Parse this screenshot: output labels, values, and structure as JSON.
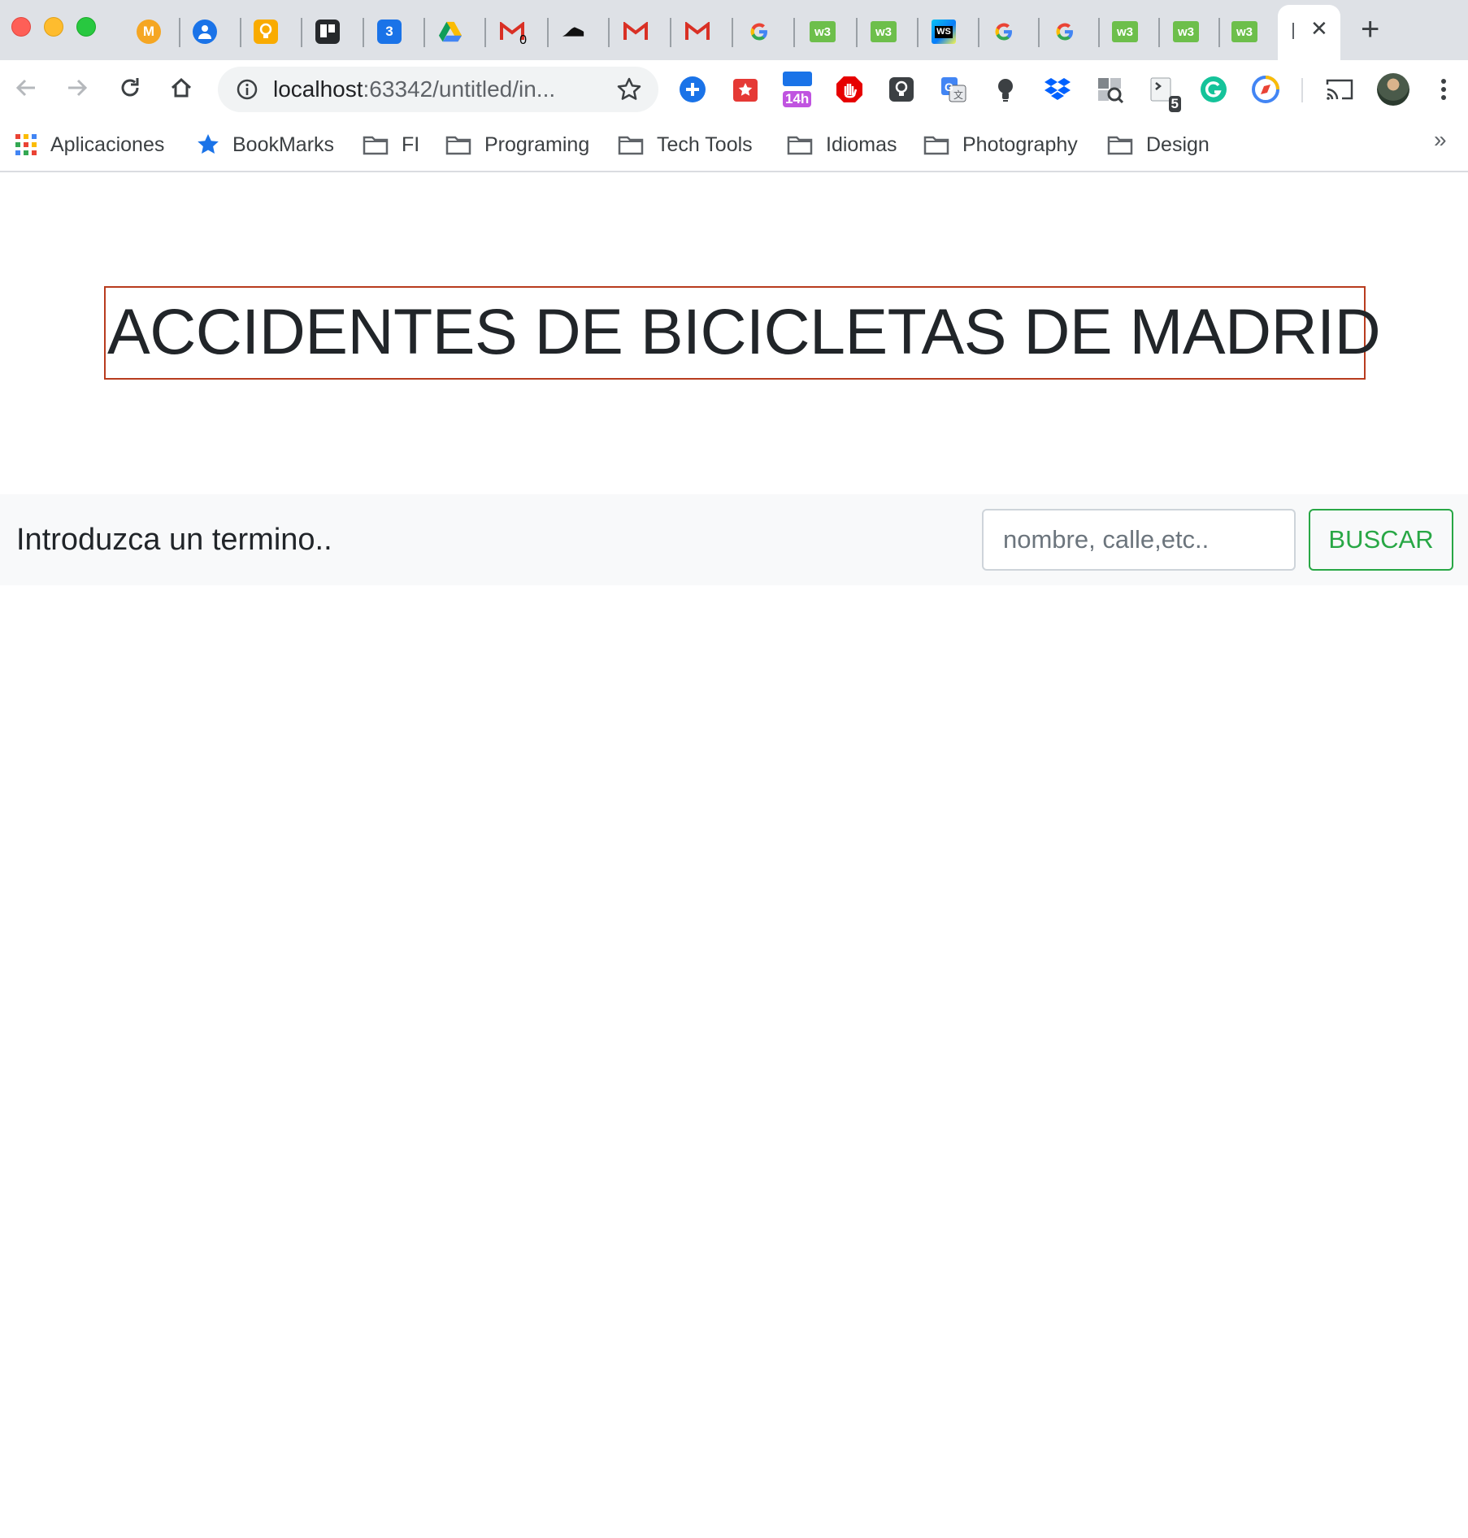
{
  "browser": {
    "tabs": [
      {
        "icon": "mail-m-icon",
        "letter": "M",
        "color": "#f5a623"
      },
      {
        "icon": "contacts-icon",
        "color": "#1a73e8"
      },
      {
        "icon": "keep-icon",
        "color": "#f9ab00"
      },
      {
        "icon": "trello-icon",
        "color": "#26292c"
      },
      {
        "icon": "calendar-icon",
        "letter": "3",
        "color": "#1a73e8"
      },
      {
        "icon": "drive-icon"
      },
      {
        "icon": "gmail-icon",
        "badge": "0"
      },
      {
        "icon": "shoe-icon"
      },
      {
        "icon": "gmail-icon"
      },
      {
        "icon": "gmail-icon"
      },
      {
        "icon": "google-icon"
      },
      {
        "icon": "w3schools-icon",
        "color": "#6dbf4b"
      },
      {
        "icon": "w3schools-icon",
        "color": "#6dbf4b"
      },
      {
        "icon": "webstorm-icon"
      },
      {
        "icon": "google-icon"
      },
      {
        "icon": "google-icon"
      },
      {
        "icon": "w3schools-icon",
        "color": "#6dbf4b"
      },
      {
        "icon": "w3schools-icon",
        "color": "#6dbf4b"
      },
      {
        "icon": "w3schools-icon",
        "color": "#6dbf4b"
      }
    ],
    "address": {
      "host": "localhost",
      "path": ":63342/untitled/in..."
    },
    "extensions": [
      {
        "icon": "add-extension-icon"
      },
      {
        "icon": "bookmark-star-icon"
      },
      {
        "icon": "timer-icon",
        "badge": "14h"
      },
      {
        "icon": "adblock-icon"
      },
      {
        "icon": "lightbulb-note-icon"
      },
      {
        "icon": "google-translate-icon"
      },
      {
        "icon": "idea-bulb-icon"
      },
      {
        "icon": "dropbox-icon"
      },
      {
        "icon": "inspect-icon"
      },
      {
        "icon": "terminal-icon",
        "badge": "5"
      },
      {
        "icon": "grammarly-icon"
      },
      {
        "icon": "compass-icon"
      }
    ],
    "bookmarks": {
      "apps_label": "Aplicaciones",
      "items": [
        "BookMarks",
        "FI",
        "Programing",
        "Tech Tools",
        "Idiomas",
        "Photography",
        "Design"
      ],
      "more": "»"
    }
  },
  "page": {
    "title": "ACCIDENTES DE BICICLETAS DE MADRID",
    "search": {
      "label": "Introduzca un termino..",
      "placeholder": "nombre, calle,etc..",
      "value": "",
      "button": "BUSCAR"
    }
  },
  "colors": {
    "title_border": "#b83c1e",
    "button_accent": "#28a745",
    "search_bar_bg": "#f8f9fa"
  }
}
